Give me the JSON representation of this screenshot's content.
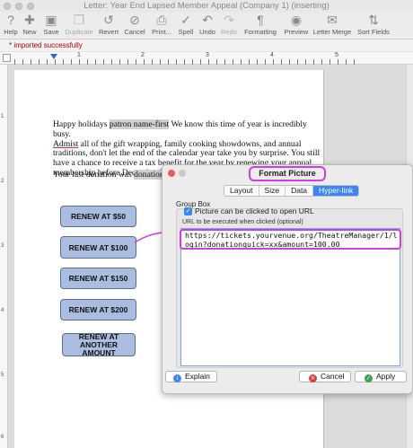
{
  "window": {
    "title": "Letter: Year End Lapsed Member Appeal (Company 1) (inserting)"
  },
  "toolbar": {
    "items": [
      {
        "label": "Help",
        "icon": "help-icon",
        "enabled": true
      },
      {
        "label": "New",
        "icon": "new-icon",
        "enabled": true
      },
      {
        "label": "Save",
        "icon": "save-icon",
        "enabled": true
      },
      {
        "label": "Duplicate",
        "icon": "duplicate-icon",
        "enabled": false
      },
      {
        "label": "Revert",
        "icon": "revert-icon",
        "enabled": true
      },
      {
        "label": "Cancel",
        "icon": "cancel-icon",
        "enabled": true
      },
      {
        "label": "Print...",
        "icon": "print-icon",
        "enabled": true
      },
      {
        "label": "Spell",
        "icon": "spell-icon",
        "enabled": true
      },
      {
        "label": "Undo",
        "icon": "undo-icon",
        "enabled": true
      },
      {
        "label": "Redo",
        "icon": "redo-icon",
        "enabled": false
      },
      {
        "label": "Formatting",
        "icon": "formatting-icon",
        "enabled": true
      },
      {
        "label": "Preview",
        "icon": "preview-icon",
        "enabled": true
      },
      {
        "label": "Letter Merge",
        "icon": "letter-merge-icon",
        "enabled": true
      },
      {
        "label": "Sort Fields",
        "icon": "sort-fields-icon",
        "enabled": true
      }
    ]
  },
  "status": {
    "message": "* imported successfully"
  },
  "ruler": {
    "numbers": [
      "1",
      "2",
      "3",
      "4",
      "5"
    ]
  },
  "vruler": {
    "numbers": [
      "1",
      "2",
      "3",
      "4",
      "5",
      "6"
    ]
  },
  "letter": {
    "p1_a": "Happy holidays ",
    "p1_field": "patron name-first",
    "p1_b": " We know this time of year is incredibly busy.",
    "p1_line2_ul": "Admist",
    "p1_line2": " all of the gift wrapping, family cooking showdowns, and annual",
    "p1_line3": "traditions, don't let the end of the calendar year take you by surprise. You still",
    "p1_line4": "have a chance to receive a tax benefit for the year by renewing your annual",
    "p1_line5": "membership before December 31st.",
    "p2_a": "Your last donation was ",
    "p2_field": "donation amo"
  },
  "renew_buttons": [
    {
      "label": "RENEW AT $50"
    },
    {
      "label": "RENEW AT $100"
    },
    {
      "label": "RENEW AT $150"
    },
    {
      "label": "RENEW AT $200"
    },
    {
      "label": "RENEW AT ANOTHER AMOUNT"
    }
  ],
  "dialog": {
    "title": "Format Picture",
    "tabs": [
      {
        "label": "Layout",
        "active": false
      },
      {
        "label": "Size",
        "active": false
      },
      {
        "label": "Data",
        "active": false
      },
      {
        "label": "Hyper-link",
        "active": true
      }
    ],
    "group_label": "Group Box",
    "checkbox_label": "Picture can be clicked to open URL",
    "checkbox_checked": true,
    "url_label": "URL to be executed when clicked (optional)",
    "url_value": "https://tickets.yourvenue.org/TheatreManager/1/login?donationquick=xx&amount=100.00",
    "explain_label": "Explain",
    "cancel_label": "Cancel",
    "apply_label": "Apply"
  },
  "colors": {
    "highlight": "#d23ce0",
    "button_fill": "#aabde0",
    "tab_active": "#3f86f5"
  }
}
